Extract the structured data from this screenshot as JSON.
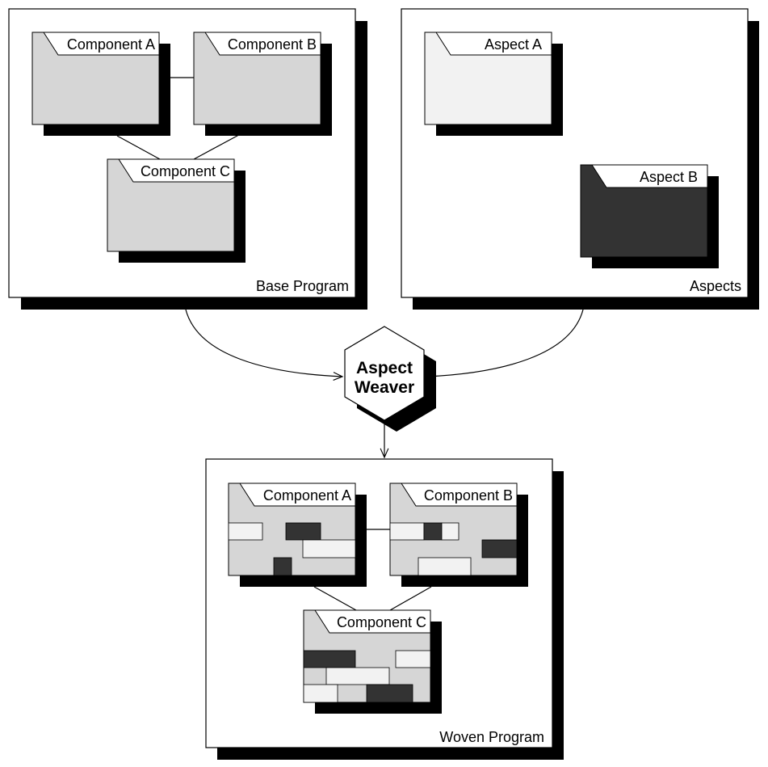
{
  "panels": {
    "base": {
      "label": "Base Program"
    },
    "aspects": {
      "label": "Aspects"
    },
    "woven": {
      "label": "Woven Program"
    }
  },
  "base_components": {
    "a": "Component A",
    "b": "Component B",
    "c": "Component C"
  },
  "aspect_modules": {
    "a": "Aspect A",
    "b": "Aspect B"
  },
  "weaver": {
    "line1": "Aspect",
    "line2": "Weaver"
  },
  "woven_components": {
    "a": "Component A",
    "b": "Component B",
    "c": "Component C"
  },
  "colors": {
    "component_fill": "#d6d6d6",
    "aspect_a_fill": "#f2f2f2",
    "aspect_b_fill": "#333333",
    "shadow": "#000000",
    "panel_fill": "#ffffff"
  }
}
